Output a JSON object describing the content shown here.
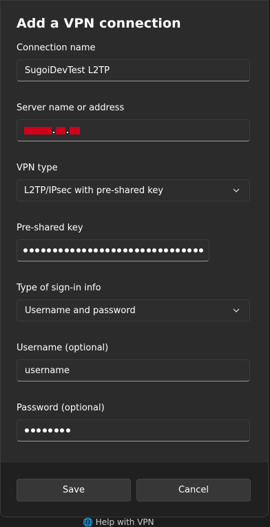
{
  "dialog": {
    "title": "Add a VPN connection",
    "connection_name": {
      "label": "Connection name",
      "value": "SugoiDevTest L2TP"
    },
    "server": {
      "label": "Server name or address",
      "value": "redacted",
      "redacted": true
    },
    "vpn_type": {
      "label": "VPN type",
      "selected": "L2TP/IPsec with pre-shared key"
    },
    "pre_shared_key": {
      "label": "Pre-shared key",
      "masked_length": 31
    },
    "sign_in_type": {
      "label": "Type of sign-in info",
      "selected": "Username and password"
    },
    "username": {
      "label": "Username (optional)",
      "value": "username"
    },
    "password": {
      "label": "Password (optional)",
      "masked_length": 8
    },
    "buttons": {
      "save": "Save",
      "cancel": "Cancel"
    }
  },
  "background": {
    "partial_item": "Help with VPN",
    "icon": "globe-icon"
  },
  "colors": {
    "dialog_bg": "#2b2b2b",
    "field_bg": "#2d2d2d",
    "footer_bg": "#202020",
    "redaction": "#d0021b"
  }
}
